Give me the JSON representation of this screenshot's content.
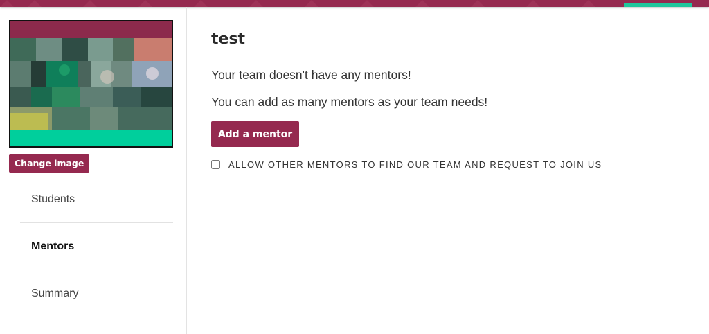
{
  "colors": {
    "brand": "#95294f",
    "accent": "#1fc69c"
  },
  "sidebar": {
    "change_image_label": "Change image",
    "nav": [
      {
        "label": "Students",
        "active": false
      },
      {
        "label": "Mentors",
        "active": true
      },
      {
        "label": "Summary",
        "active": false
      }
    ]
  },
  "main": {
    "title": "test",
    "no_mentors_message": "Your team doesn't have any mentors!",
    "add_info_message": "You can add as many mentors as your team needs!",
    "add_mentor_label": "Add a mentor",
    "allow_mentors_label": "ALLOW OTHER MENTORS TO FIND OUR TEAM AND REQUEST TO JOIN US",
    "allow_mentors_checked": false
  }
}
